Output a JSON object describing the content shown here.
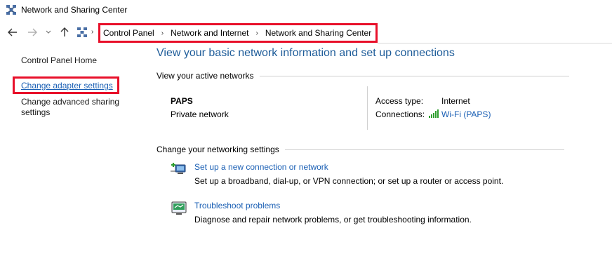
{
  "window": {
    "title": "Network and Sharing Center"
  },
  "nav": {
    "breadcrumbs": [
      "Control Panel",
      "Network and Internet",
      "Network and Sharing Center"
    ]
  },
  "sidebar": {
    "home": "Control Panel Home",
    "adapter": "Change adapter settings",
    "advanced": "Change advanced sharing settings"
  },
  "main": {
    "title": "View your basic network information and set up connections",
    "active_networks_heading": "View your active networks",
    "network": {
      "name": "PAPS",
      "type": "Private network",
      "access_type_label": "Access type:",
      "access_type_value": "Internet",
      "connections_label": "Connections:",
      "connections_value": "Wi-Fi (PAPS)"
    },
    "settings_heading": "Change your networking settings",
    "tasks": [
      {
        "link": "Set up a new connection or network",
        "desc": "Set up a broadband, dial-up, or VPN connection; or set up a router or access point.",
        "icon": "new-connection-icon"
      },
      {
        "link": "Troubleshoot problems",
        "desc": "Diagnose and repair network problems, or get troubleshooting information.",
        "icon": "troubleshoot-icon"
      }
    ]
  },
  "colors": {
    "link": "#1a5fb4",
    "title": "#1e5c99",
    "highlight": "#e8102a"
  }
}
